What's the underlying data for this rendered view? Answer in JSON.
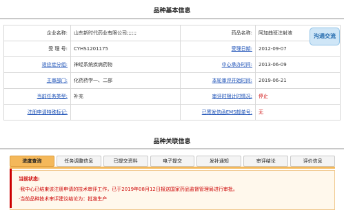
{
  "basic": {
    "title": "品种基本信息",
    "badge": "沟通交流",
    "rows": [
      {
        "l1": "企业名称:",
        "v1": "山东新时代药业有限公司;;;;;;",
        "l2": "药品名称:",
        "v2": "阿加曲班注射液"
      },
      {
        "l1": "受 理 号:",
        "v1": "CYHS1201175",
        "l2": "受理日期:",
        "v2": "2012-09-07"
      },
      {
        "l1": "适应症分组:",
        "v1": "神经系统疾病药物",
        "l2": "中心承办时间:",
        "v2": "2013-06-09"
      },
      {
        "l1": "主审部门:",
        "v1": "化药药学一、二部",
        "l2": "本轮审评开始时间:",
        "v2": "2019-06-21"
      },
      {
        "l1": "当前任务类型:",
        "v1": "补充",
        "l2": "审评时限计时情况:",
        "v2": "停止"
      },
      {
        "l1": "注册申请特殊标记:",
        "v1": "",
        "l2": "已寄发信函EMS邮单号:",
        "v2": "无"
      }
    ]
  },
  "related": {
    "title": "品种关联信息",
    "tabs": [
      "进度查询",
      "任务调整信息",
      "已提交资料",
      "电子提交",
      "发补通知",
      "审评结论",
      "评价信息"
    ]
  },
  "notice": {
    "title": "当前状态:",
    "line1": "·我中心已结束该注册申请的技术审评工作，已于2019年08月12日报送国家药品监督管理局进行审批。",
    "line2": "·当前品种技术审评建议结论为：批准生产"
  }
}
